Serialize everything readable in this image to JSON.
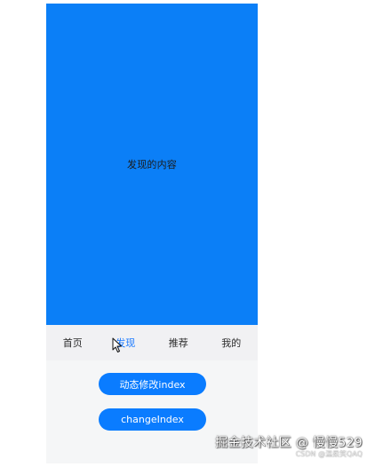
{
  "content": {
    "text": "发现的内容"
  },
  "tabs": [
    {
      "label": "首页",
      "active": false
    },
    {
      "label": "发现",
      "active": true
    },
    {
      "label": "推荐",
      "active": false
    },
    {
      "label": "我的",
      "active": false
    }
  ],
  "buttons": {
    "dynamic_change": "动态修改index",
    "change_index": "changeIndex"
  },
  "watermark": {
    "main": "掘金技术社区 @ 慢慢529",
    "sub": "CSDN @温柔笑QAQ"
  },
  "colors": {
    "content_background": "#0b7ff7",
    "tab_active": "#1677ff",
    "button": "#0a7cff"
  },
  "icons": {
    "cursor": "pointer-cursor-icon"
  }
}
